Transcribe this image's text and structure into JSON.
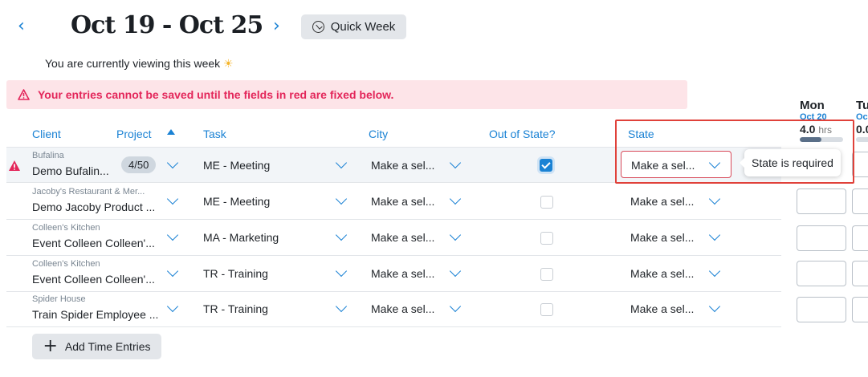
{
  "header": {
    "prev_icon": "chevron-left-icon",
    "next_icon": "chevron-right-icon",
    "title": "Oct 19 - Oct 25",
    "quick_week_label": "Quick Week",
    "quick_week_icon": "clock-icon",
    "viewing_text": "You are currently viewing this week",
    "sun_icon": "sun-emoji"
  },
  "error_banner": {
    "icon": "warning-icon",
    "text": "Your entries cannot be saved until the fields in red are fixed below.",
    "color": "#e3265a"
  },
  "columns": {
    "client": "Client",
    "project": "Project",
    "task": "Task",
    "city": "City",
    "out_of_state": "Out of State?",
    "state": "State"
  },
  "days": [
    {
      "name": "Mon",
      "date": "Oct 20",
      "hours": "4.0",
      "unit": "hrs",
      "progress": 0.5
    },
    {
      "name": "Tu",
      "date": "Oc",
      "hours": "0.0"
    }
  ],
  "rows": [
    {
      "client_small": "Bufalina",
      "client_main": "Demo Bufalin...",
      "badge": "4/50",
      "task": "ME - Meeting",
      "city": "Make a sel...",
      "out_of_state": true,
      "state": "Make a sel...",
      "error": true
    },
    {
      "client_small": "Jacoby's Restaurant & Mer...",
      "client_main": "Demo Jacoby Product ...",
      "task": "ME - Meeting",
      "city": "Make a sel...",
      "out_of_state": false,
      "state": "Make a sel..."
    },
    {
      "client_small": "Colleen's Kitchen",
      "client_main": "Event Colleen Colleen'...",
      "task": "MA - Marketing",
      "city": "Make a sel...",
      "out_of_state": false,
      "state": "Make a sel..."
    },
    {
      "client_small": "Colleen's Kitchen",
      "client_main": "Event Colleen Colleen'...",
      "task": "TR - Training",
      "city": "Make a sel...",
      "out_of_state": false,
      "state": "Make a sel..."
    },
    {
      "client_small": "Spider House",
      "client_main": "Train Spider Employee ...",
      "task": "TR - Training",
      "city": "Make a sel...",
      "out_of_state": false,
      "state": "Make a sel..."
    }
  ],
  "tooltip": {
    "text": "State is required"
  },
  "add_button": {
    "label": "Add Time Entries",
    "icon": "plus-icon"
  },
  "colors": {
    "accent": "#1a82d4",
    "error": "#e3265a",
    "highlight": "#e0413a"
  }
}
